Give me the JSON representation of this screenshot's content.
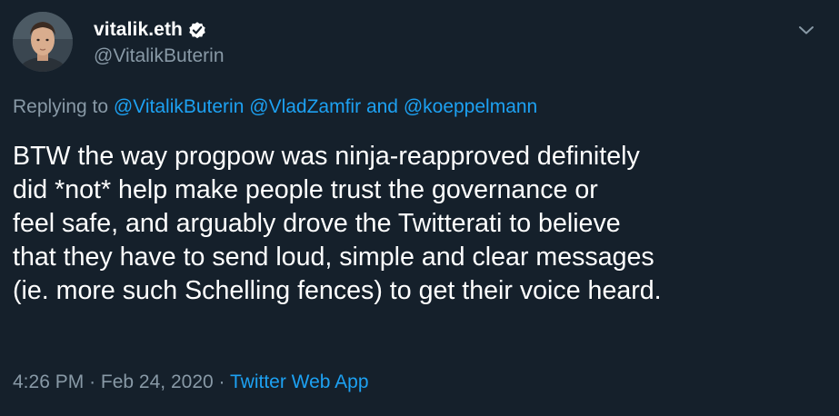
{
  "tweet": {
    "display_name": "vitalik.eth",
    "handle": "@VitalikButerin",
    "replying_prefix": "Replying to",
    "mentions": [
      "@VitalikButerin",
      "@VladZamfir",
      "@koeppelmann"
    ],
    "mention_conjunction": "and",
    "body_lines": [
      "BTW the way progpow was ninja-reapproved definitely",
      "did *not* help make people trust the governance or",
      "feel safe, and arguably drove the Twitterati to believe",
      "that they have to send loud, simple and clear messages",
      "(ie. more such Schelling fences) to get their voice heard."
    ],
    "time": "4:26 PM",
    "separator": "·",
    "date": "Feb 24, 2020",
    "source_app": "Twitter Web App"
  },
  "icons": {
    "verified": "verified-badge-icon",
    "menu": "chevron-down-icon",
    "avatar": "profile-photo"
  },
  "colors": {
    "background": "#15202b",
    "primary_text": "#ffffff",
    "secondary_text": "#8899a6",
    "link": "#1da1f2"
  }
}
